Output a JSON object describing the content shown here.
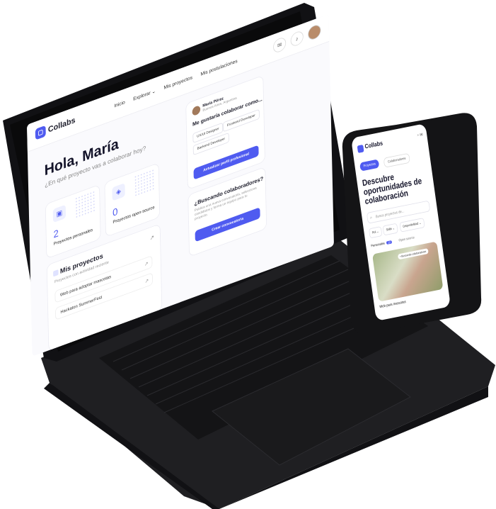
{
  "laptop": {
    "brand": "Collabs",
    "nav": [
      "Inicio",
      "Explorar ⌄",
      "Mis proyectos",
      "Mis postulaciones"
    ],
    "greeting": "Hola, María",
    "subgreeting": "¿En qué proyecto vas a colaborar hoy?",
    "stats": [
      {
        "value": "2",
        "label": "Proyectos personales"
      },
      {
        "value": "0",
        "label": "Proyectos open-source"
      }
    ],
    "projects": {
      "title": "Mis proyectos",
      "subtitle": "Proyectos con actividad reciente",
      "items": [
        "Web para adoptar mascotas",
        "Hackaton SummerFest"
      ]
    },
    "profile": {
      "name": "María Pérez",
      "location": "Buenos Aires, Argentina",
      "question": "Me gustaría colaborar como...",
      "roles": [
        "UX/UI Designer",
        "Frontend Developer",
        "Backend Developer"
      ],
      "button": "Actualizar perfil profesional"
    },
    "search_card": {
      "title": "¿Buscando colaboradores?",
      "description": "Publica una nueva convocatoria, selecciona candidatos y forma un equipo para tu proyecto.",
      "button": "Crear convocatoria"
    }
  },
  "phone": {
    "brand": "Collabs",
    "tabs": [
      "Proyectos",
      "Colaboradores"
    ],
    "heading": "Descubre oportunidades de colaboración",
    "search_placeholder": "Busca proyectos de...",
    "filters": [
      "Rol ⌄",
      "Skills ⌄",
      "Disponibilidad ⌄"
    ],
    "segment_personal": "Personales",
    "segment_personal_count": "12",
    "segment_open": "Open source",
    "photo_badge": "• Buscando colaboradores",
    "card_title": "Web para mascotas"
  },
  "colors": {
    "accent": "#4f5bf0",
    "laptop_shell": "#1c1c1f",
    "background": "#ffffff"
  }
}
